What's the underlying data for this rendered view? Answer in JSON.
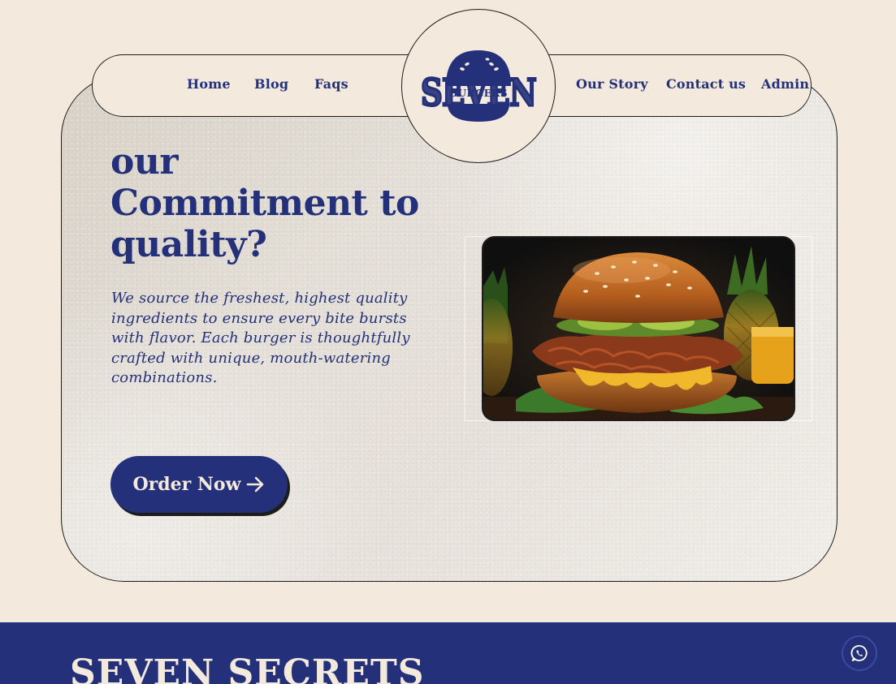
{
  "nav": {
    "left_links": [
      "Home",
      "Blog",
      "Faqs"
    ],
    "right_links": [
      "Our Story",
      "Contact us",
      "Admin"
    ]
  },
  "logo": {
    "word": "SEVEN",
    "sub": "BURGERS"
  },
  "hero": {
    "heading_lines": [
      "our",
      "Commitment to",
      "quality?"
    ],
    "description": "We source the freshest, highest quality ingredients to ensure every bite bursts with flavor. Each burger is thoughtfully crafted with unique, mouth-watering combinations.",
    "cta_label": "Order Now"
  },
  "next_section": {
    "title": "SEVEN SECRETS"
  },
  "icons": {
    "cta_arrow": "arrow-right-icon",
    "floating": "whatsapp-icon"
  },
  "colors": {
    "brand_blue": "#24317a",
    "cream": "#f3e9dc",
    "outline": "#1c1c1c"
  }
}
